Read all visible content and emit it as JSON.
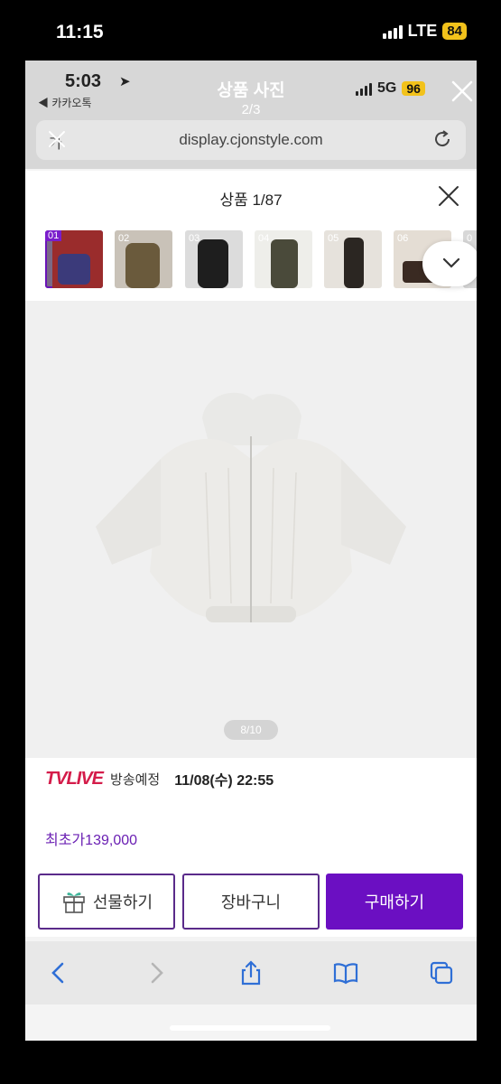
{
  "outer_status": {
    "time": "11:15",
    "network": "LTE",
    "battery": "84"
  },
  "inner_status": {
    "time": "5:03",
    "back_app": "◀ 카카오톡",
    "network": "5G",
    "battery": "96"
  },
  "viewer": {
    "title": "상품 사진",
    "page": "2/3"
  },
  "browser": {
    "url": "display.cjonstyle.com",
    "left_label": "가"
  },
  "panel": {
    "title": "상품 1/87",
    "thumbnails": [
      {
        "num": "01",
        "selected": true
      },
      {
        "num": "02"
      },
      {
        "num": "03"
      },
      {
        "num": "04"
      },
      {
        "num": "05"
      },
      {
        "num": "06"
      },
      {
        "num": "0"
      }
    ],
    "image_counter": "8/10"
  },
  "broadcast": {
    "logo": "TVLIVE",
    "status": "방송예정",
    "datetime": "11/08(수) 22:55"
  },
  "price": {
    "label": "최초가",
    "value": "139,000"
  },
  "actions": {
    "gift": "선물하기",
    "cart": "장바구니",
    "buy": "구매하기"
  },
  "colors": {
    "accent": "#6b0fc2",
    "tvlive": "#d41c4a",
    "battery": "#f2c21b"
  }
}
